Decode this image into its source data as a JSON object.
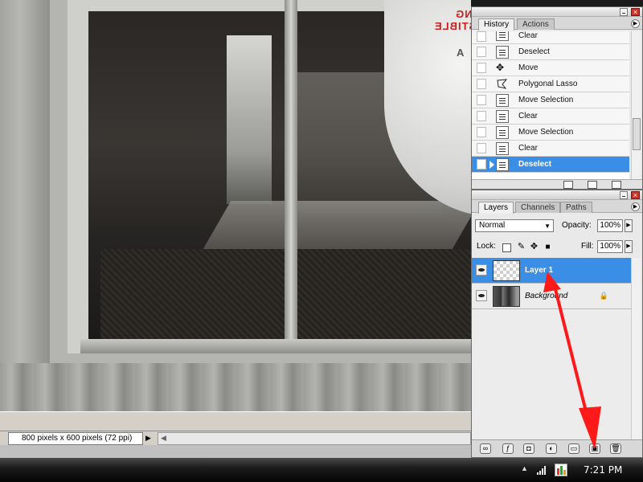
{
  "status_bar": {
    "doc_info": "800 pixels x 600 pixels (72 ppi)"
  },
  "taskbar": {
    "clock": "7:21 PM"
  },
  "canvas_sign": {
    "text_line1": "ING",
    "text_line2": "STIBLE",
    "text_line3": "A"
  },
  "history_panel": {
    "tabs": [
      "History",
      "Actions"
    ],
    "items": [
      {
        "label": "Clear"
      },
      {
        "label": "Deselect"
      },
      {
        "label": "Move"
      },
      {
        "label": "Polygonal Lasso"
      },
      {
        "label": "Move Selection"
      },
      {
        "label": "Clear"
      },
      {
        "label": "Move Selection"
      },
      {
        "label": "Clear"
      },
      {
        "label": "Deselect"
      }
    ],
    "selected_index": 8
  },
  "layers_panel": {
    "tabs": [
      "Layers",
      "Channels",
      "Paths"
    ],
    "blend_mode": "Normal",
    "opacity_label": "Opacity:",
    "opacity_value": "100%",
    "lock_label": "Lock:",
    "fill_label": "Fill:",
    "fill_value": "100%",
    "layers": [
      {
        "name": "Layer 1",
        "selected": true
      },
      {
        "name": "Background",
        "selected": false,
        "locked": true
      }
    ]
  },
  "colors": {
    "selection": "#3a8ee6",
    "annotation_arrow": "#ff1a1a"
  }
}
